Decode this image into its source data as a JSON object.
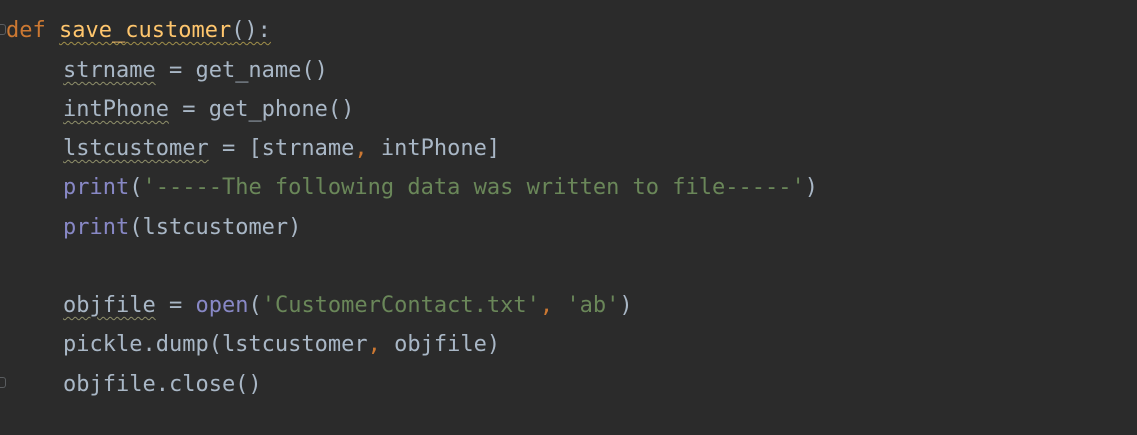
{
  "code": {
    "line1": {
      "keyword": "def",
      "name": "save_customer",
      "suffix": "():"
    },
    "line2": {
      "var": "strname",
      "rest": " = get_name()"
    },
    "line3": {
      "var": "intPhone",
      "rest": " = get_phone()"
    },
    "line4": {
      "var": "lstcustomer",
      "mid": " = [strname",
      "comma": ",",
      "rest": " intPhone]"
    },
    "line5": {
      "builtin": "print",
      "open": "(",
      "string": "'-----The following data was written to file-----'",
      "close": ")"
    },
    "line6": {
      "builtin": "print",
      "rest": "(lstcustomer)"
    },
    "line7": {
      "var": "objfile",
      "eq": " = ",
      "builtin": "open",
      "open": "(",
      "string1": "'CustomerContact.txt'",
      "comma": ",",
      "space": " ",
      "string2": "'ab'",
      "close": ")"
    },
    "line8": {
      "start": "pickle.dump(lstcustomer",
      "comma": ",",
      "rest": " objfile)"
    },
    "line9": {
      "text": "objfile.close()"
    }
  },
  "colors": {
    "background": "#2b2b2b",
    "keyword": "#cc7832",
    "function_name": "#ffc66d",
    "builtin": "#8888c6",
    "string": "#6a8759",
    "default_text": "#a9b7c6"
  }
}
